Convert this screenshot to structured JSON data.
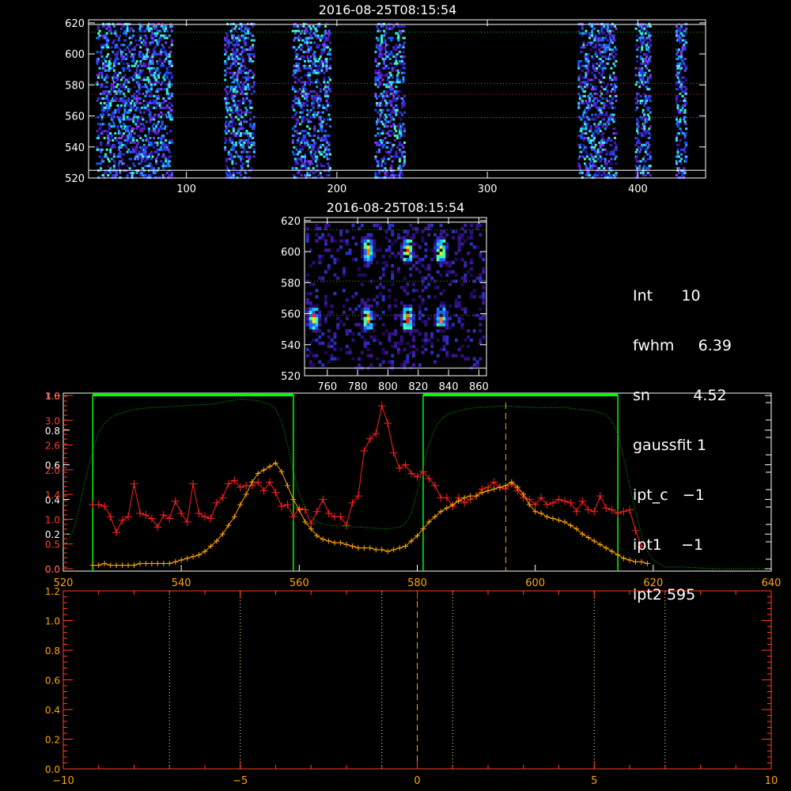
{
  "panel_top": {
    "title": "2016-08-25T08:15:54",
    "x_ticks": [
      "100",
      "200",
      "300",
      "400"
    ],
    "y_ticks": [
      "520",
      "540",
      "560",
      "580",
      "600",
      "620"
    ]
  },
  "panel_mid": {
    "title": "2016-08-25T08:15:54",
    "x_ticks": [
      "760",
      "780",
      "800",
      "820",
      "840",
      "860"
    ],
    "y_ticks": [
      "520",
      "540",
      "560",
      "580",
      "600",
      "620"
    ]
  },
  "stats": [
    {
      "label": "Int",
      "value": "10"
    },
    {
      "label": "fwhm",
      "value": "6.39"
    },
    {
      "label": "sn",
      "value": "4.52"
    },
    {
      "label": "gaussfit",
      "value": "1"
    },
    {
      "label": "ipt_c",
      "value": "−1"
    },
    {
      "label": "ipt1",
      "value": "−1"
    },
    {
      "label": "ipt2",
      "value": "595"
    }
  ],
  "colors": {
    "red": "#ff2020",
    "orange": "#ffa500",
    "green": "#00ff00",
    "axis": "#ffffff"
  },
  "chart_data": [
    {
      "type": "heatmap",
      "title": "2016-08-25T08:15:54",
      "xlim": [
        35,
        445
      ],
      "ylim": [
        520,
        622
      ],
      "hlines": {
        "white": [
          525,
          619
        ],
        "green_dotted": [
          559,
          581,
          614
        ],
        "red_dotted": [
          574
        ]
      },
      "pixel_columns": [
        [
          40,
          90
        ],
        [
          125,
          145
        ],
        [
          170,
          195
        ],
        [
          225,
          245
        ],
        [
          360,
          385
        ],
        [
          398,
          408
        ],
        [
          425,
          432
        ]
      ]
    },
    {
      "type": "heatmap",
      "title": "2016-08-25T08:15:54",
      "xlim": [
        745,
        865
      ],
      "ylim": [
        520,
        622
      ],
      "hlines": {
        "white": [
          525,
          619
        ],
        "green_dotted": [
          559,
          581,
          614
        ]
      }
    },
    {
      "type": "line",
      "xlim": [
        520,
        640
      ],
      "x_ticks": [
        "520",
        "540",
        "560",
        "580",
        "600",
        "620",
        "640"
      ],
      "y_ticks_left_white": [
        "0.0",
        "0.2",
        "0.4",
        "0.6",
        "0.8",
        "1.0"
      ],
      "y_ticks_left_red": [
        "0.0",
        "0.5",
        "1.0",
        "1.4",
        "2.0",
        "2.6",
        "3.0",
        "3.8"
      ],
      "box_green": [
        [
          525,
          559
        ],
        [
          581,
          614
        ]
      ],
      "vline_orange": 595,
      "series": [
        {
          "color": "red",
          "x": [
            525,
            526,
            527,
            528,
            529,
            530,
            531,
            532,
            533,
            534,
            535,
            536,
            537,
            538,
            539,
            540,
            541,
            542,
            543,
            544,
            545,
            546,
            547,
            548,
            549,
            550,
            551,
            552,
            553,
            554,
            555,
            556,
            557,
            558,
            559,
            560,
            561,
            562,
            563,
            564,
            565,
            566,
            567,
            568,
            569,
            570,
            571,
            572,
            573,
            574,
            575,
            576,
            577,
            578,
            579,
            580,
            581,
            582,
            583,
            584,
            585,
            586,
            587,
            588,
            589,
            590,
            591,
            592,
            593,
            594,
            595,
            596,
            597,
            598,
            599,
            600,
            601,
            602,
            603,
            604,
            605,
            606,
            607,
            608,
            609,
            610,
            611,
            612,
            613,
            614,
            615,
            616,
            617,
            618
          ],
          "y": [
            0.37,
            0.37,
            0.36,
            0.3,
            0.21,
            0.28,
            0.3,
            0.49,
            0.32,
            0.31,
            0.29,
            0.24,
            0.31,
            0.29,
            0.39,
            0.32,
            0.27,
            0.49,
            0.32,
            0.3,
            0.29,
            0.38,
            0.41,
            0.49,
            0.51,
            0.47,
            0.48,
            0.48,
            0.5,
            0.45,
            0.5,
            0.44,
            0.36,
            0.37,
            0.3,
            0.35,
            0.34,
            0.26,
            0.33,
            0.4,
            0.32,
            0.3,
            0.3,
            0.25,
            0.38,
            0.42,
            0.68,
            0.75,
            0.78,
            0.94,
            0.84,
            0.67,
            0.58,
            0.6,
            0.55,
            0.53,
            0.56,
            0.52,
            0.48,
            0.41,
            0.41,
            0.36,
            0.41,
            0.38,
            0.4,
            0.42,
            0.46,
            0.47,
            0.5,
            0.47,
            0.46,
            0.49,
            0.45,
            0.41,
            0.4,
            0.37,
            0.41,
            0.37,
            0.38,
            0.4,
            0.39,
            0.38,
            0.33,
            0.39,
            0.34,
            0.33,
            0.42,
            0.35,
            0.34,
            0.32,
            0.33,
            0.34,
            0.22,
            0.13
          ]
        },
        {
          "color": "orange",
          "x": [
            525,
            526,
            527,
            528,
            529,
            530,
            531,
            532,
            533,
            534,
            535,
            536,
            537,
            538,
            539,
            540,
            541,
            542,
            543,
            544,
            545,
            546,
            547,
            548,
            549,
            550,
            551,
            552,
            553,
            554,
            555,
            556,
            557,
            558,
            559,
            560,
            561,
            562,
            563,
            564,
            565,
            566,
            567,
            568,
            569,
            570,
            571,
            572,
            573,
            574,
            575,
            576,
            577,
            578,
            579,
            580,
            581,
            582,
            583,
            584,
            585,
            586,
            587,
            588,
            589,
            590,
            591,
            592,
            593,
            594,
            595,
            596,
            597,
            598,
            599,
            600,
            601,
            602,
            603,
            604,
            605,
            606,
            607,
            608,
            609,
            610,
            611,
            612,
            613,
            614,
            615,
            616,
            617,
            618,
            619
          ],
          "y": [
            0.02,
            0.02,
            0.03,
            0.02,
            0.02,
            0.02,
            0.02,
            0.02,
            0.03,
            0.03,
            0.03,
            0.03,
            0.03,
            0.03,
            0.04,
            0.05,
            0.06,
            0.07,
            0.08,
            0.1,
            0.13,
            0.16,
            0.2,
            0.25,
            0.3,
            0.37,
            0.43,
            0.5,
            0.55,
            0.57,
            0.59,
            0.61,
            0.56,
            0.48,
            0.4,
            0.34,
            0.27,
            0.23,
            0.19,
            0.17,
            0.16,
            0.15,
            0.15,
            0.14,
            0.13,
            0.12,
            0.12,
            0.12,
            0.11,
            0.11,
            0.1,
            0.11,
            0.12,
            0.13,
            0.16,
            0.19,
            0.23,
            0.27,
            0.3,
            0.33,
            0.35,
            0.37,
            0.39,
            0.41,
            0.42,
            0.42,
            0.44,
            0.45,
            0.46,
            0.47,
            0.48,
            0.5,
            0.47,
            0.43,
            0.37,
            0.33,
            0.32,
            0.3,
            0.29,
            0.28,
            0.27,
            0.25,
            0.23,
            0.2,
            0.18,
            0.16,
            0.14,
            0.12,
            0.1,
            0.08,
            0.06,
            0.05,
            0.04,
            0.04,
            0.03
          ]
        },
        {
          "color": "green-dotted",
          "x": [
            520,
            521,
            522,
            523,
            524,
            525,
            526,
            527,
            528,
            529,
            530,
            532,
            535,
            540,
            545,
            550,
            553,
            555,
            556,
            557,
            558,
            559,
            560,
            561,
            562,
            563,
            565,
            570,
            575,
            577,
            578,
            579,
            580,
            581,
            582,
            583,
            584,
            585,
            586,
            587,
            588,
            590,
            595,
            600,
            605,
            610,
            612,
            613,
            614,
            615,
            616,
            617,
            618,
            619,
            620,
            621,
            622,
            625,
            630,
            635,
            640
          ],
          "y": [
            0.13,
            0.17,
            0.25,
            0.4,
            0.55,
            0.68,
            0.79,
            0.84,
            0.87,
            0.89,
            0.9,
            0.92,
            0.93,
            0.94,
            0.95,
            0.98,
            0.97,
            0.95,
            0.92,
            0.85,
            0.72,
            0.56,
            0.43,
            0.35,
            0.3,
            0.27,
            0.25,
            0.24,
            0.23,
            0.24,
            0.26,
            0.32,
            0.45,
            0.6,
            0.72,
            0.81,
            0.86,
            0.89,
            0.9,
            0.91,
            0.92,
            0.93,
            0.94,
            0.93,
            0.93,
            0.91,
            0.89,
            0.85,
            0.78,
            0.64,
            0.48,
            0.33,
            0.2,
            0.1,
            0.05,
            0.03,
            0.01,
            0.01,
            0.0,
            0.0,
            0.0
          ]
        }
      ]
    },
    {
      "type": "line",
      "xlim": [
        -10,
        10
      ],
      "ylim": [
        0,
        1.2
      ],
      "x_ticks": [
        "−10",
        "−5",
        "0",
        "5",
        "10"
      ],
      "y_ticks": [
        "0.0",
        "0.2",
        "0.4",
        "0.6",
        "0.8",
        "1.0",
        "1.2"
      ],
      "dotted_vlines_yellow": [
        -7,
        -5,
        -1,
        1,
        5,
        7
      ],
      "dashed_vline_orange": 0
    }
  ]
}
